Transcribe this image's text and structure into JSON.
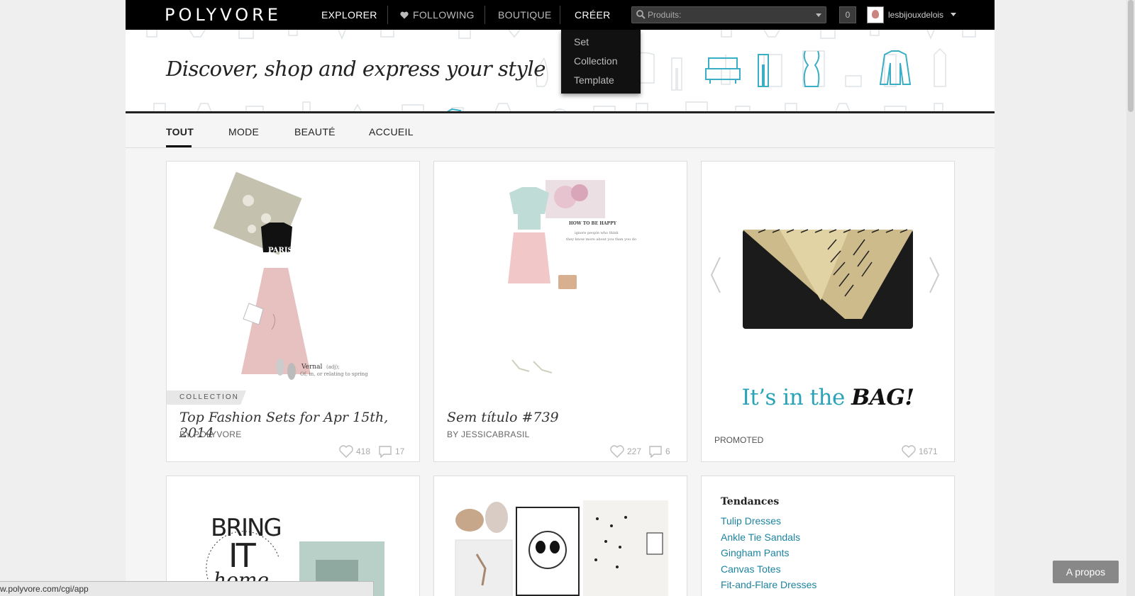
{
  "nav": {
    "logo": "POLYVORE",
    "explorer": "EXPLORER",
    "following": "FOLLOWING",
    "boutique": "BOUTIQUE",
    "creer": "CRÉER",
    "search_placeholder": "Produits:",
    "count": "0",
    "username": "lesbijouxdelois"
  },
  "creer_menu": [
    "Set",
    "Collection",
    "Template"
  ],
  "hero": {
    "tagline": "Discover, shop and express your style"
  },
  "tabs": [
    "TOUT",
    "MODE",
    "BEAUTÉ",
    "ACCUEIL"
  ],
  "cards": [
    {
      "ribbon": "COLLECTION",
      "title": "Top Fashion Sets for Apr 15th, 2014",
      "by": "BY POLYVORE",
      "likes": "418",
      "comments": "17",
      "caption_word": "Vernal",
      "caption_note": "(adj);",
      "caption_sub": "Of, in, or relating to spring",
      "shirt_text": "PARIS"
    },
    {
      "title": "Sem título #739",
      "by": "BY JESSICABRASIL",
      "likes": "227",
      "comments": "6",
      "caption_title": "HOW TO BE HAPPY",
      "caption_sub1": "ignore people who think",
      "caption_sub2": "they know more about you than you do"
    },
    {
      "headline_a": "It’s in the ",
      "headline_b": "BAG!",
      "promoted": "PROMOTED",
      "likes": "1671"
    }
  ],
  "row2": {
    "card1_line1": "BRING",
    "card1_line2": "IT",
    "card1_line3": "home"
  },
  "trends": {
    "title": "Tendances",
    "items": [
      "Tulip Dresses",
      "Ankle Tie Sandals",
      "Gingham Pants",
      "Canvas Totes",
      "Fit-and-Flare Dresses"
    ]
  },
  "status_url": "w.polyvore.com/cgi/app",
  "apropos": "A propos",
  "colors": {
    "accent": "#2aa3b8",
    "link": "#1d84a0",
    "nav_bg": "#000000"
  }
}
